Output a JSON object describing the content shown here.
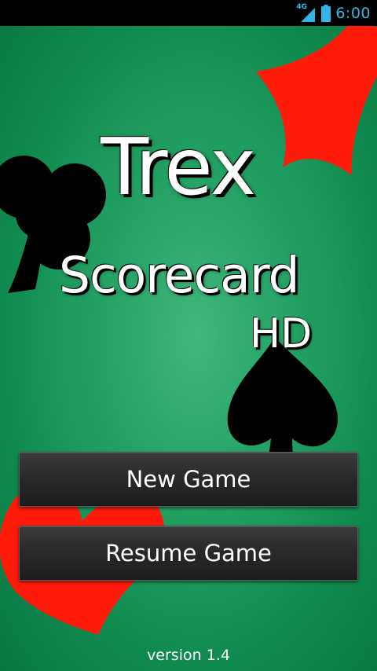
{
  "status_bar": {
    "network_label": "4G",
    "time": "6:00",
    "icons": [
      "signal-icon",
      "battery-icon"
    ]
  },
  "title": {
    "line1": "Trex",
    "line2": "Scorecard",
    "line3": "HD"
  },
  "buttons": {
    "new_game": "New Game",
    "resume_game": "Resume Game"
  },
  "footer": {
    "version": "version 1.4"
  },
  "colors": {
    "felt_green": "#22a063",
    "suit_red": "#ff1a0a",
    "suit_black": "#000000",
    "status_accent": "#33b5e5",
    "button_dark": "#2a2a2a"
  },
  "decorations": [
    "diamond-suit",
    "club-suit",
    "spade-suit",
    "heart-suit"
  ]
}
